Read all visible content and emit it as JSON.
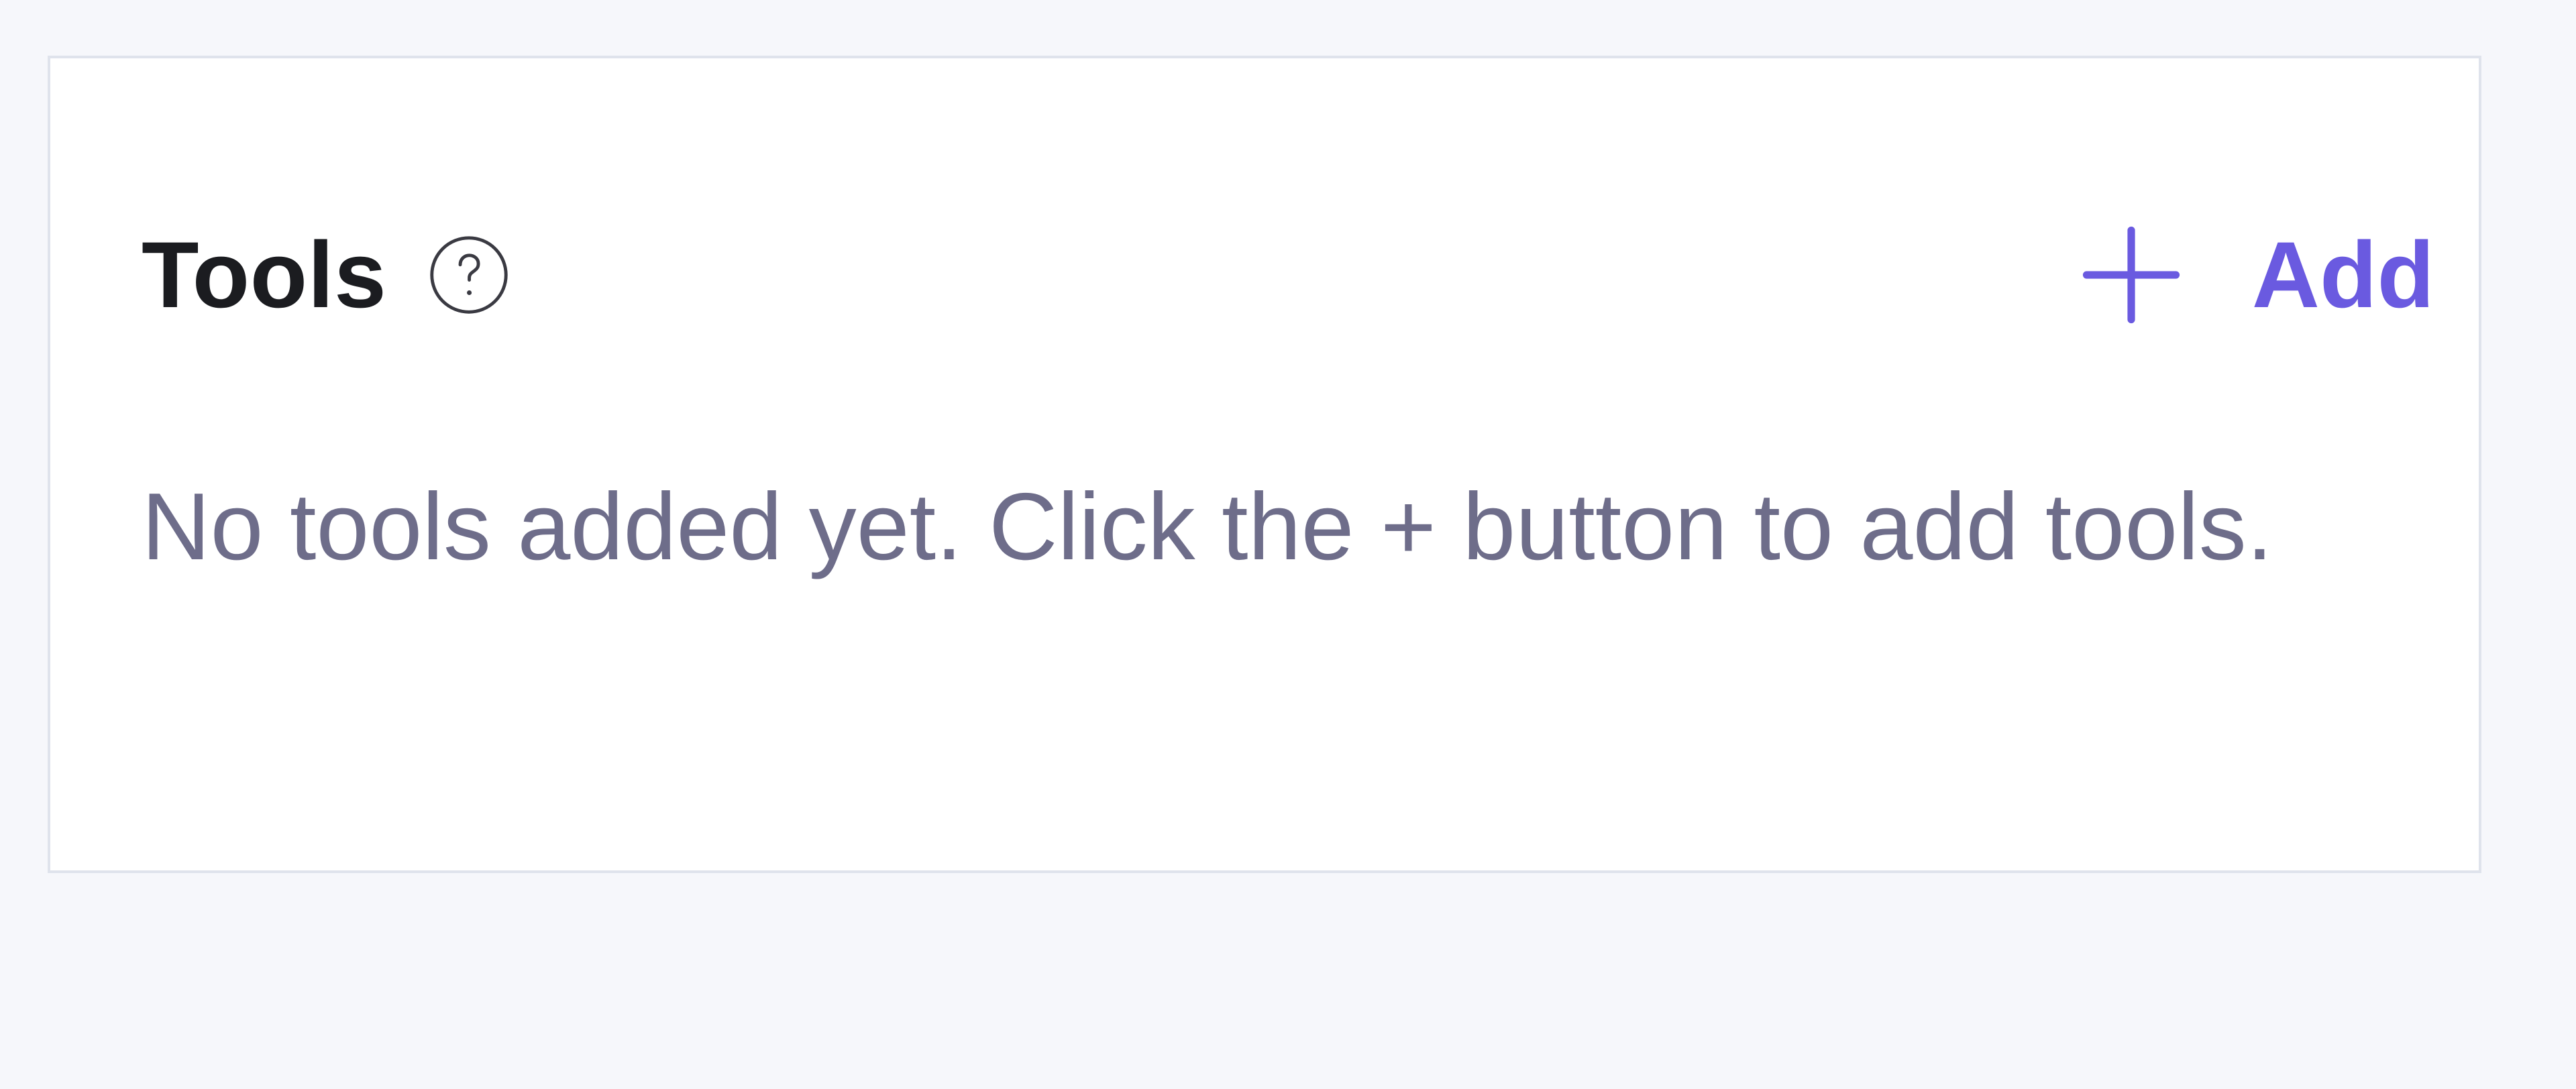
{
  "tools_panel": {
    "title": "Tools",
    "help_icon": "question-circle-icon",
    "add_icon": "plus-icon",
    "add_label": "Add",
    "empty_message": "No tools added yet. Click the + button to add tools."
  },
  "colors": {
    "background": "#f6f7fb",
    "card": "#ffffff",
    "border": "#dfe3ec",
    "title": "#1b1c20",
    "accent": "#6a5ae0",
    "muted_text": "#6e6d8a"
  }
}
